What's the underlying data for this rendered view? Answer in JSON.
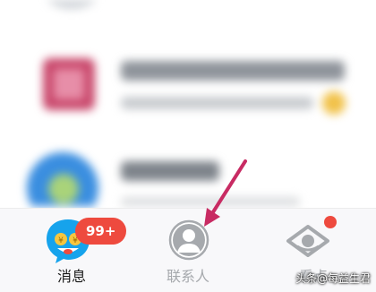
{
  "tab_bar": {
    "tabs": [
      {
        "label": "消息",
        "icon": "chat-bubble-icon",
        "active": true,
        "badge": "99+"
      },
      {
        "label": "联系人",
        "icon": "contacts-person-icon",
        "active": false
      },
      {
        "label": "看点",
        "icon": "eye-view-icon",
        "active": false,
        "dot": true
      }
    ]
  },
  "colors": {
    "accent_red": "#ee4a3e",
    "active_tab_text": "#1a1a1a",
    "inactive_tab_text": "#a6a9ad",
    "annotation_arrow": "#c82b63"
  },
  "watermark": "头条@每益生君"
}
